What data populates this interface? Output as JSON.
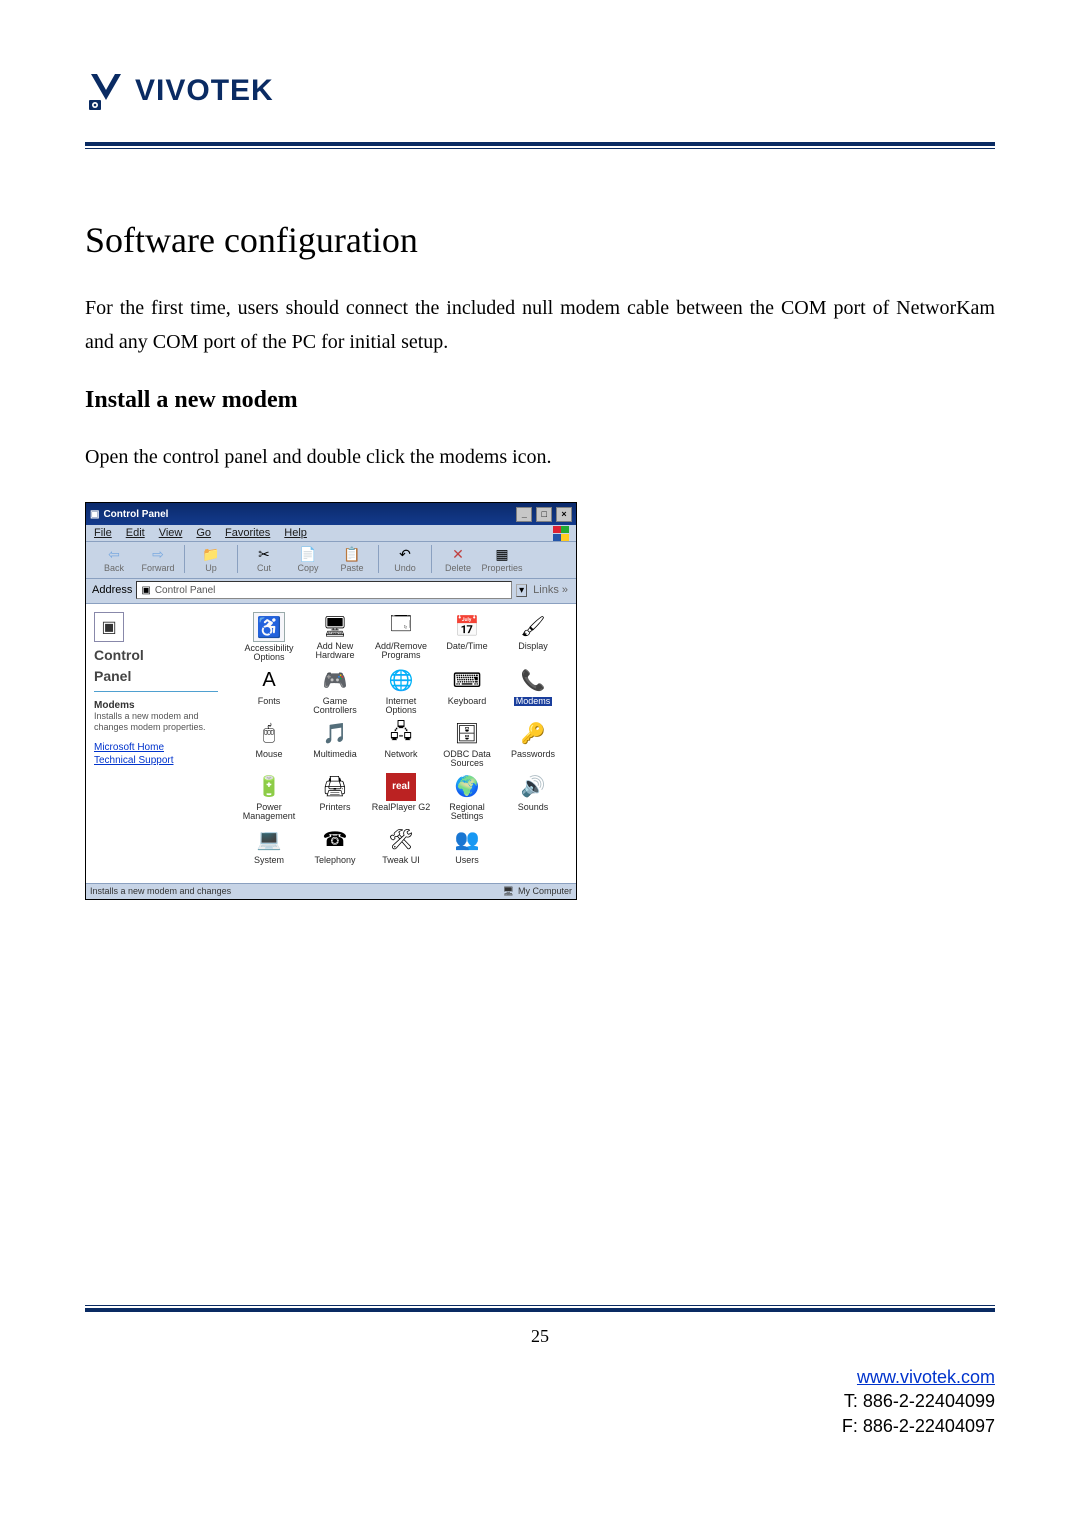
{
  "logo": {
    "brand": "VIVOTEK"
  },
  "section": {
    "title": "Software configuration",
    "intro": "For the first time, users should connect the included null modem cable between the COM port of NetworKam and any COM port of the PC for initial setup.",
    "sub": "Install a new modem",
    "instruction": "Open the control panel and double click the modems icon."
  },
  "screenshot": {
    "title": "Control Panel",
    "minimize": "_",
    "maximize": "□",
    "close": "×",
    "menus": [
      "File",
      "Edit",
      "View",
      "Go",
      "Favorites",
      "Help"
    ],
    "toolbar": {
      "back": {
        "glyph": "⇦",
        "label": "Back"
      },
      "forward": {
        "glyph": "⇨",
        "label": "Forward"
      },
      "up": {
        "glyph": "📁",
        "label": "Up"
      },
      "cut": {
        "glyph": "✂",
        "label": "Cut"
      },
      "copy": {
        "glyph": "📄",
        "label": "Copy"
      },
      "paste": {
        "glyph": "📋",
        "label": "Paste"
      },
      "undo": {
        "glyph": "↶",
        "label": "Undo"
      },
      "delete": {
        "glyph": "✕",
        "label": "Delete"
      },
      "props": {
        "glyph": "▦",
        "label": "Properties"
      }
    },
    "address": {
      "label": "Address",
      "value": "Control Panel"
    },
    "links": "Links »",
    "side": {
      "heading1": "Control",
      "heading2": "Panel",
      "item_title": "Modems",
      "item_desc": "Installs a new modem and changes modem properties.",
      "link1": "Microsoft Home",
      "link2": "Technical Support"
    },
    "items": [
      {
        "glyph": "♿",
        "label": "Accessibility Options",
        "boxed": true
      },
      {
        "glyph": "🖥",
        "label": "Add New Hardware"
      },
      {
        "glyph": "🗔",
        "label": "Add/Remove Programs"
      },
      {
        "glyph": "📅",
        "label": "Date/Time"
      },
      {
        "glyph": "🖌",
        "label": "Display"
      },
      {
        "glyph": "A",
        "label": "Fonts"
      },
      {
        "glyph": "🎮",
        "label": "Game Controllers"
      },
      {
        "glyph": "🌐",
        "label": "Internet Options"
      },
      {
        "glyph": "⌨",
        "label": "Keyboard"
      },
      {
        "glyph": "📞",
        "label": "Modems",
        "selected": true
      },
      {
        "glyph": "🖱",
        "label": "Mouse"
      },
      {
        "glyph": "🎵",
        "label": "Multimedia"
      },
      {
        "glyph": "🖧",
        "label": "Network"
      },
      {
        "glyph": "🗄",
        "label": "ODBC Data Sources"
      },
      {
        "glyph": "🔑",
        "label": "Passwords"
      },
      {
        "glyph": "🔋",
        "label": "Power Management"
      },
      {
        "glyph": "🖨",
        "label": "Printers"
      },
      {
        "glyph": "real",
        "label": "RealPlayer G2",
        "real": true
      },
      {
        "glyph": "🌍",
        "label": "Regional Settings"
      },
      {
        "glyph": "🔊",
        "label": "Sounds"
      },
      {
        "glyph": "💻",
        "label": "System"
      },
      {
        "glyph": "☎",
        "label": "Telephony"
      },
      {
        "glyph": "🛠",
        "label": "Tweak UI"
      },
      {
        "glyph": "👥",
        "label": "Users"
      }
    ],
    "status": {
      "left": "Installs a new modem and changes",
      "right": "My Computer"
    }
  },
  "footer": {
    "page_number": "25",
    "url": "www.vivotek.com",
    "tel": "T: 886-2-22404099",
    "fax": "F: 886-2-22404097"
  }
}
